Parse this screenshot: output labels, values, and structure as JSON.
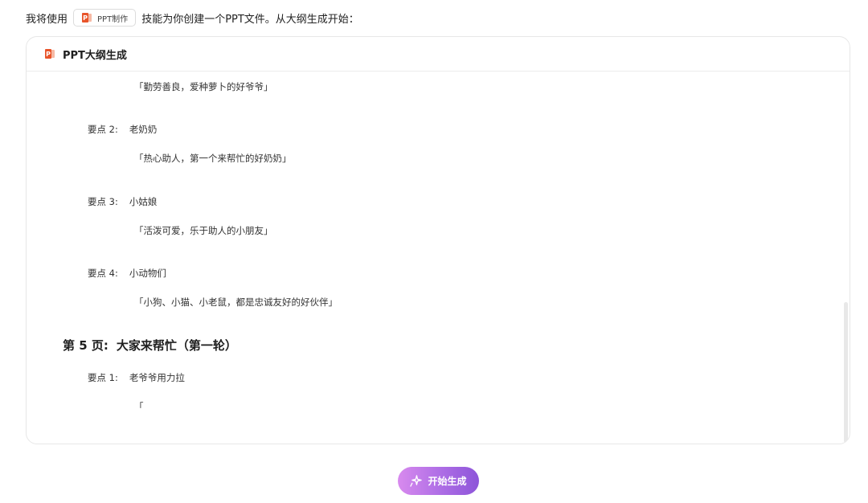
{
  "intro": {
    "before": "我将使用",
    "skill_chip": "PPT制作",
    "after": "技能为你创建一个PPT文件。从大纲生成开始："
  },
  "card": {
    "title": "PPT大纲生成",
    "lines": [
      {
        "kind": "quote",
        "text": "「勤劳善良，爱种萝卜的好爷爷」"
      },
      {
        "kind": "point",
        "label": "要点 2:",
        "text": "老奶奶"
      },
      {
        "kind": "quote",
        "text": "「热心助人，第一个来帮忙的好奶奶」"
      },
      {
        "kind": "point",
        "label": "要点 3:",
        "text": "小姑娘"
      },
      {
        "kind": "quote",
        "text": "「活泼可爱，乐于助人的小朋友」"
      },
      {
        "kind": "point",
        "label": "要点 4:",
        "text": "小动物们"
      },
      {
        "kind": "quote",
        "text": "「小狗、小猫、小老鼠，都是忠诚友好的好伙伴」"
      },
      {
        "kind": "page",
        "label": "第 5 页:",
        "text": "大家来帮忙（第一轮）"
      },
      {
        "kind": "point",
        "label": "要点 1:",
        "text": "老爷爷用力拉"
      },
      {
        "kind": "quote",
        "text": "「"
      }
    ]
  },
  "start_button": {
    "label": "开始生成",
    "icon": "sparkle-icon"
  },
  "colors": {
    "ppt_orange": "#e8542a",
    "button_gradient_start": "#d88aee",
    "button_gradient_end": "#8d55d9"
  }
}
